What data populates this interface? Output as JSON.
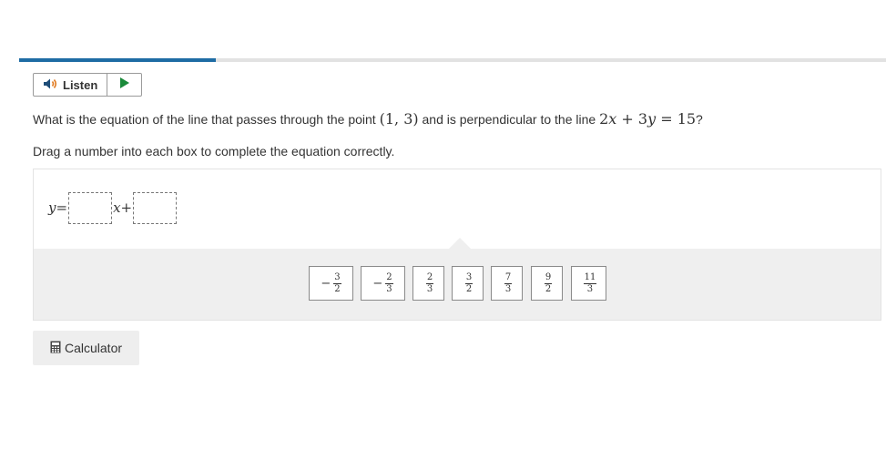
{
  "progress": {
    "percent": 22.7,
    "fill_color": "#1e6ca4",
    "track_color": "#e2e2e2"
  },
  "toolbar": {
    "listen_label": "Listen",
    "speaker_icon": "speaker-icon",
    "play_icon": "play-icon",
    "play_color": "#1a8a3a"
  },
  "question": {
    "prefix": "What is the equation of the line that passes through the point ",
    "point": "(1, 3)",
    "middle": " and is perpendicular to the line ",
    "line_eq": {
      "t1": "2",
      "v1": "x",
      "op": " + ",
      "t2": "3",
      "v2": "y",
      "eq": " = ",
      "rhs": "15"
    },
    "suffix": "?"
  },
  "instruction": "Drag a number into each box to complete the equation correctly.",
  "equation": {
    "lhs": "y",
    "equals": " = ",
    "var": "x",
    "plus": " + "
  },
  "tiles": [
    {
      "sign": "−",
      "num": "3",
      "den": "2"
    },
    {
      "sign": "−",
      "num": "2",
      "den": "3"
    },
    {
      "sign": "",
      "num": "2",
      "den": "3"
    },
    {
      "sign": "",
      "num": "3",
      "den": "2"
    },
    {
      "sign": "",
      "num": "7",
      "den": "3"
    },
    {
      "sign": "",
      "num": "9",
      "den": "2"
    },
    {
      "sign": "",
      "num": "11",
      "den": "3"
    }
  ],
  "calculator": {
    "label": "Calculator",
    "icon": "calculator-icon"
  }
}
